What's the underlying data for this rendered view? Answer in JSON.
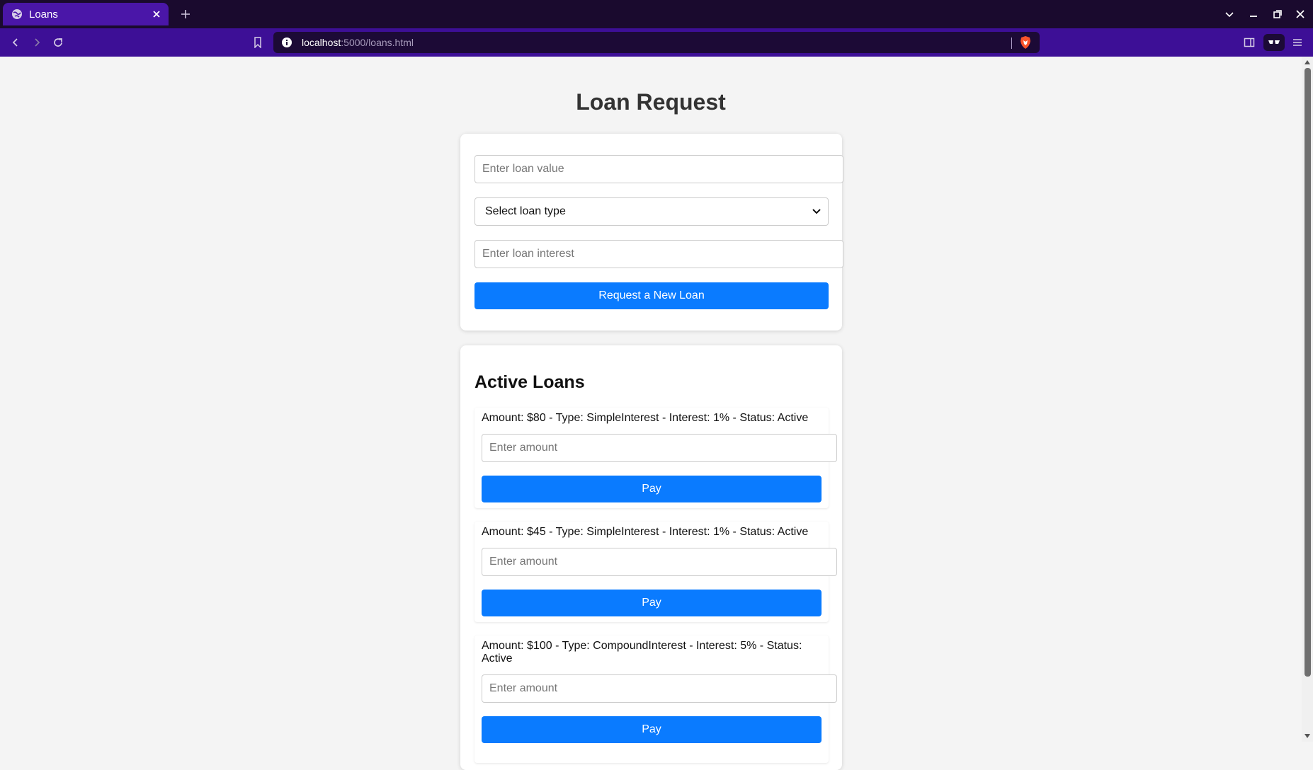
{
  "browser": {
    "tab_title": "Loans",
    "url_host": "localhost",
    "url_path": ":5000/loans.html"
  },
  "page": {
    "title": "Loan Request"
  },
  "form": {
    "loan_value_placeholder": "Enter loan value",
    "loan_type_selected": "Select loan type",
    "loan_interest_placeholder": "Enter loan interest",
    "submit_label": "Request a New Loan"
  },
  "active_loans": {
    "title": "Active Loans",
    "amount_placeholder": "Enter amount",
    "pay_label": "Pay",
    "items": [
      {
        "text": "Amount: $80 - Type: SimpleInterest - Interest: 1% - Status: Active"
      },
      {
        "text": "Amount: $45 - Type: SimpleInterest - Interest: 1% - Status: Active"
      },
      {
        "text": "Amount: $100 - Type: CompoundInterest - Interest: 5% - Status: Active"
      }
    ]
  },
  "colors": {
    "accent": "#0a7bff",
    "tab_active": "#4a16a8",
    "toolbar": "#3d0f96",
    "tabbar": "#1a0a2e",
    "page_bg": "#f4f4f4"
  }
}
